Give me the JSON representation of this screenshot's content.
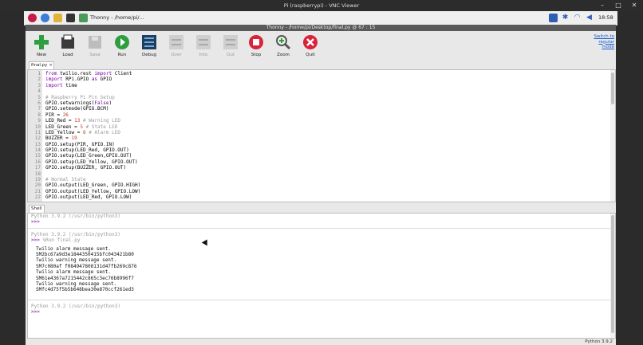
{
  "vnc": {
    "title": "Pi (raspberrypi) - VNC Viewer"
  },
  "pi_panel": {
    "app_label": "Thonny - /home/pi/...",
    "clock": "18:58"
  },
  "thonny": {
    "title": "Thonny - /home/pi/Desktop/final.py @ 67 : 15",
    "toolbar": [
      {
        "name": "new",
        "label": "New",
        "enabled": true
      },
      {
        "name": "load",
        "label": "Load",
        "enabled": true
      },
      {
        "name": "save",
        "label": "Save",
        "enabled": false
      },
      {
        "name": "run",
        "label": "Run",
        "enabled": true
      },
      {
        "name": "debug",
        "label": "Debug",
        "enabled": true
      },
      {
        "name": "over",
        "label": "Over",
        "enabled": false
      },
      {
        "name": "into",
        "label": "Into",
        "enabled": false
      },
      {
        "name": "out",
        "label": "Out",
        "enabled": false
      },
      {
        "name": "stop",
        "label": "Stop",
        "enabled": true
      },
      {
        "name": "zoom",
        "label": "Zoom",
        "enabled": true
      },
      {
        "name": "quit",
        "label": "Quit",
        "enabled": true
      }
    ],
    "mode_switch": "Switch to regular mode",
    "editor_tab": "final.py",
    "editor_tab_close": "×",
    "code": [
      {
        "n": "1",
        "t": "from twilio.rest import Client"
      },
      {
        "n": "2",
        "t": "import RPi.GPIO as GPIO"
      },
      {
        "n": "3",
        "t": "import time"
      },
      {
        "n": "4",
        "t": ""
      },
      {
        "n": "5",
        "t": "# Raspberry Pi Pin Setup"
      },
      {
        "n": "6",
        "t": "GPIO.setwarnings(False)"
      },
      {
        "n": "7",
        "t": "GPIO.setmode(GPIO.BCM)"
      },
      {
        "n": "8",
        "t": "PIR = 26"
      },
      {
        "n": "9",
        "t": "LED_Red = 13 # Warning LED"
      },
      {
        "n": "10",
        "t": "LED_Green = 5 # State LED"
      },
      {
        "n": "11",
        "t": "LED_Yellow = 6 # Alarm LED"
      },
      {
        "n": "12",
        "t": "BUZZER = 19"
      },
      {
        "n": "13",
        "t": "GPIO.setup(PIR, GPIO.IN)"
      },
      {
        "n": "14",
        "t": "GPIO.setup(LED_Red, GPIO.OUT)"
      },
      {
        "n": "15",
        "t": "GPIO.setup(LED_Green,GPIO.OUT)"
      },
      {
        "n": "16",
        "t": "GPIO.setup(LED_Yellow, GPIO.OUT)"
      },
      {
        "n": "17",
        "t": "GPIO.setup(BUZZER, GPIO.OUT)"
      },
      {
        "n": "18",
        "t": ""
      },
      {
        "n": "19",
        "t": "# Normal State"
      },
      {
        "n": "20",
        "t": "GPIO.output(LED_Green, GPIO.HIGH)"
      },
      {
        "n": "21",
        "t": "GPIO.output(LED_Yellow, GPIO.LOW)"
      },
      {
        "n": "22",
        "t": "GPIO.output(LED_Red, GPIO.LOW)"
      }
    ],
    "shell_tab": "Shell",
    "shell": {
      "banner1": "Python 3.9.2 (/usr/bin/python3)",
      "prompt1": ">>>",
      "banner2": "Python 3.9.2 (/usr/bin/python3)",
      "prompt2": ">>>",
      "run_cmd": "%Run final.py",
      "output": [
        "Twilio alarm message sent.",
        "SM2bc67a9d3e1844350415bfc043421b80",
        "Twilio warning message sent.",
        "SM7c080af f084947808131d47fb269c876",
        "Twilio alarm message sent.",
        "SM61e4367a7215442c865c3ec76b8996f7",
        "Twilio warning message sent.",
        "SMfc4d75f5b5b648bea30e870ccf261ed3"
      ],
      "banner3": "Python 3.9.2 (/usr/bin/python3)",
      "prompt3": ">>>"
    },
    "status": "Python 3.9.2"
  }
}
